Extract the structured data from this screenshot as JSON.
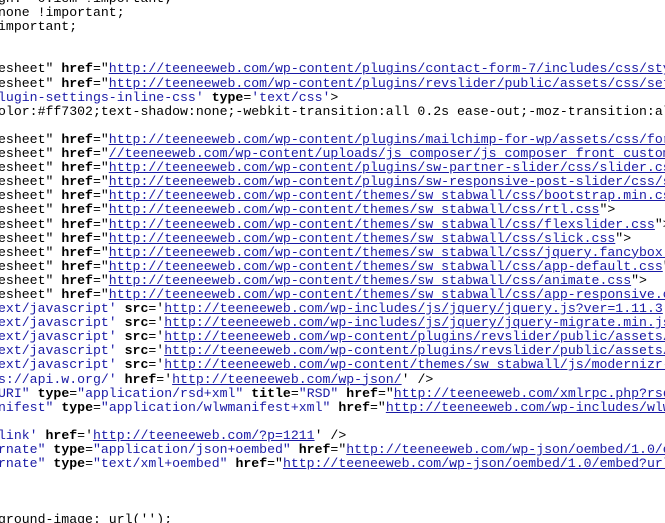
{
  "colors": {
    "text": "#000000",
    "value": "#1a1aa6",
    "background": "#ffffff"
  },
  "lines": [
    [
      [
        "t",
        "gn: -0.1em !important;"
      ]
    ],
    [
      [
        "t",
        "none !important;"
      ]
    ],
    [
      [
        "t",
        "important;"
      ]
    ],
    [],
    [],
    [
      [
        "t",
        "esheet\" "
      ],
      [
        "a",
        "href"
      ],
      [
        "t",
        "=\""
      ],
      [
        "l",
        "http://teeneeweb.com/wp-content/plugins/contact-form-7/includes/css/styl"
      ]
    ],
    [
      [
        "t",
        "esheet\" "
      ],
      [
        "a",
        "href"
      ],
      [
        "t",
        "=\""
      ],
      [
        "l",
        "http://teeneeweb.com/wp-content/plugins/revslider/public/assets/css/sett"
      ]
    ],
    [
      [
        "v",
        "lugin-settings-inline-css'"
      ],
      [
        "t",
        " "
      ],
      [
        "a",
        "type"
      ],
      [
        "t",
        "="
      ],
      [
        "v",
        "'text/css'"
      ],
      [
        "t",
        ">"
      ]
    ],
    [
      [
        "t",
        "olor:#ff7302;text-shadow:none;-webkit-transition:all 0.2s ease-out;-moz-transition:all"
      ]
    ],
    [],
    [
      [
        "t",
        "esheet\" "
      ],
      [
        "a",
        "href"
      ],
      [
        "t",
        "=\""
      ],
      [
        "l",
        "http://teeneeweb.com/wp-content/plugins/mailchimp-for-wp/assets/css/form"
      ]
    ],
    [
      [
        "t",
        "esheet\" "
      ],
      [
        "a",
        "href"
      ],
      [
        "t",
        "=\""
      ],
      [
        "l",
        "//teeneeweb.com/wp-content/uploads/js_composer/js_composer_front_custom."
      ]
    ],
    [
      [
        "t",
        "esheet\" "
      ],
      [
        "a",
        "href"
      ],
      [
        "t",
        "=\""
      ],
      [
        "l",
        "http://teeneeweb.com/wp-content/plugins/sw-partner-slider/css/slider.css"
      ]
    ],
    [
      [
        "t",
        "esheet\" "
      ],
      [
        "a",
        "href"
      ],
      [
        "t",
        "=\""
      ],
      [
        "l",
        "http://teeneeweb.com/wp-content/plugins/sw-responsive-post-slider/css/sl"
      ]
    ],
    [
      [
        "t",
        "esheet\" "
      ],
      [
        "a",
        "href"
      ],
      [
        "t",
        "=\""
      ],
      [
        "l",
        "http://teeneeweb.com/wp-content/themes/sw_stabwall/css/bootstrap.min.css"
      ]
    ],
    [
      [
        "t",
        "esheet\" "
      ],
      [
        "a",
        "href"
      ],
      [
        "t",
        "=\""
      ],
      [
        "l",
        "http://teeneeweb.com/wp-content/themes/sw_stabwall/css/rtl.css"
      ],
      [
        "t",
        "\">"
      ]
    ],
    [
      [
        "t",
        "esheet\" "
      ],
      [
        "a",
        "href"
      ],
      [
        "t",
        "=\""
      ],
      [
        "l",
        "http://teeneeweb.com/wp-content/themes/sw_stabwall/css/flexslider.css"
      ],
      [
        "t",
        "\">"
      ]
    ],
    [
      [
        "t",
        "esheet\" "
      ],
      [
        "a",
        "href"
      ],
      [
        "t",
        "=\""
      ],
      [
        "l",
        "http://teeneeweb.com/wp-content/themes/sw_stabwall/css/slick.css"
      ],
      [
        "t",
        "\">"
      ]
    ],
    [
      [
        "t",
        "esheet\" "
      ],
      [
        "a",
        "href"
      ],
      [
        "t",
        "=\""
      ],
      [
        "l",
        "http://teeneeweb.com/wp-content/themes/sw_stabwall/css/jquery.fancybox.c"
      ]
    ],
    [
      [
        "t",
        "esheet\" "
      ],
      [
        "a",
        "href"
      ],
      [
        "t",
        "=\""
      ],
      [
        "l",
        "http://teeneeweb.com/wp-content/themes/sw_stabwall/css/app-default.css"
      ],
      [
        "t",
        "\">"
      ]
    ],
    [
      [
        "t",
        "esheet\" "
      ],
      [
        "a",
        "href"
      ],
      [
        "t",
        "=\""
      ],
      [
        "l",
        "http://teeneeweb.com/wp-content/themes/sw_stabwall/css/animate.css"
      ],
      [
        "t",
        "\">"
      ]
    ],
    [
      [
        "t",
        "esheet\" "
      ],
      [
        "a",
        "href"
      ],
      [
        "t",
        "=\""
      ],
      [
        "l",
        "http://teeneeweb.com/wp-content/themes/sw_stabwall/css/app-responsive.cs"
      ]
    ],
    [
      [
        "v",
        "ext/javascript'"
      ],
      [
        "t",
        " "
      ],
      [
        "a",
        "src"
      ],
      [
        "t",
        "='"
      ],
      [
        "l",
        "http://teeneeweb.com/wp-includes/js/jquery/jquery.js?ver=1.11.3"
      ],
      [
        "t",
        "'>"
      ]
    ],
    [
      [
        "v",
        "ext/javascript'"
      ],
      [
        "t",
        " "
      ],
      [
        "a",
        "src"
      ],
      [
        "t",
        "='"
      ],
      [
        "l",
        "http://teeneeweb.com/wp-includes/js/jquery/jquery-migrate.min.js?"
      ]
    ],
    [
      [
        "v",
        "ext/javascript'"
      ],
      [
        "t",
        " "
      ],
      [
        "a",
        "src"
      ],
      [
        "t",
        "='"
      ],
      [
        "l",
        "http://teeneeweb.com/wp-content/plugins/revslider/public/assets/j"
      ]
    ],
    [
      [
        "v",
        "ext/javascript'"
      ],
      [
        "t",
        " "
      ],
      [
        "a",
        "src"
      ],
      [
        "t",
        "='"
      ],
      [
        "l",
        "http://teeneeweb.com/wp-content/plugins/revslider/public/assets/j"
      ]
    ],
    [
      [
        "v",
        "ext/javascript'"
      ],
      [
        "t",
        " "
      ],
      [
        "a",
        "src"
      ],
      [
        "t",
        "='"
      ],
      [
        "l",
        "http://teeneeweb.com/wp-content/themes/sw_stabwall/js/modernizr-2"
      ]
    ],
    [
      [
        "v",
        "s://api.w.org/'"
      ],
      [
        "t",
        " "
      ],
      [
        "a",
        "href"
      ],
      [
        "t",
        "='"
      ],
      [
        "l",
        "http://teeneeweb.com/wp-json/"
      ],
      [
        "t",
        "' />"
      ]
    ],
    [
      [
        "v",
        "URI\""
      ],
      [
        "t",
        " "
      ],
      [
        "a",
        "type"
      ],
      [
        "t",
        "="
      ],
      [
        "v",
        "\"application/rsd+xml\""
      ],
      [
        "t",
        " "
      ],
      [
        "a",
        "title"
      ],
      [
        "t",
        "="
      ],
      [
        "v",
        "\"RSD\""
      ],
      [
        "t",
        " "
      ],
      [
        "a",
        "href"
      ],
      [
        "t",
        "=\""
      ],
      [
        "l",
        "http://teeneeweb.com/xmlrpc.php?rsd"
      ],
      [
        "t",
        "\""
      ]
    ],
    [
      [
        "v",
        "nifest\""
      ],
      [
        "t",
        " "
      ],
      [
        "a",
        "type"
      ],
      [
        "t",
        "="
      ],
      [
        "v",
        "\"application/wlwmanifest+xml\""
      ],
      [
        "t",
        " "
      ],
      [
        "a",
        "href"
      ],
      [
        "t",
        "=\""
      ],
      [
        "l",
        "http://teeneeweb.com/wp-includes/wlw"
      ]
    ],
    [],
    [
      [
        "v",
        "link'"
      ],
      [
        "t",
        " "
      ],
      [
        "a",
        "href"
      ],
      [
        "t",
        "='"
      ],
      [
        "l",
        "http://teeneeweb.com/?p=1211"
      ],
      [
        "t",
        "' />"
      ]
    ],
    [
      [
        "v",
        "rnate\""
      ],
      [
        "t",
        " "
      ],
      [
        "a",
        "type"
      ],
      [
        "t",
        "="
      ],
      [
        "v",
        "\"application/json+oembed\""
      ],
      [
        "t",
        " "
      ],
      [
        "a",
        "href"
      ],
      [
        "t",
        "=\""
      ],
      [
        "l",
        "http://teeneeweb.com/wp-json/oembed/1.0/em"
      ]
    ],
    [
      [
        "v",
        "rnate\""
      ],
      [
        "t",
        " "
      ],
      [
        "a",
        "type"
      ],
      [
        "t",
        "="
      ],
      [
        "v",
        "\"text/xml+oembed\""
      ],
      [
        "t",
        " "
      ],
      [
        "a",
        "href"
      ],
      [
        "t",
        "=\""
      ],
      [
        "l",
        "http://teeneeweb.com/wp-json/oembed/1.0/embed?url="
      ]
    ],
    [],
    [],
    [],
    [
      [
        "t",
        "ground-image: url('');"
      ]
    ]
  ]
}
